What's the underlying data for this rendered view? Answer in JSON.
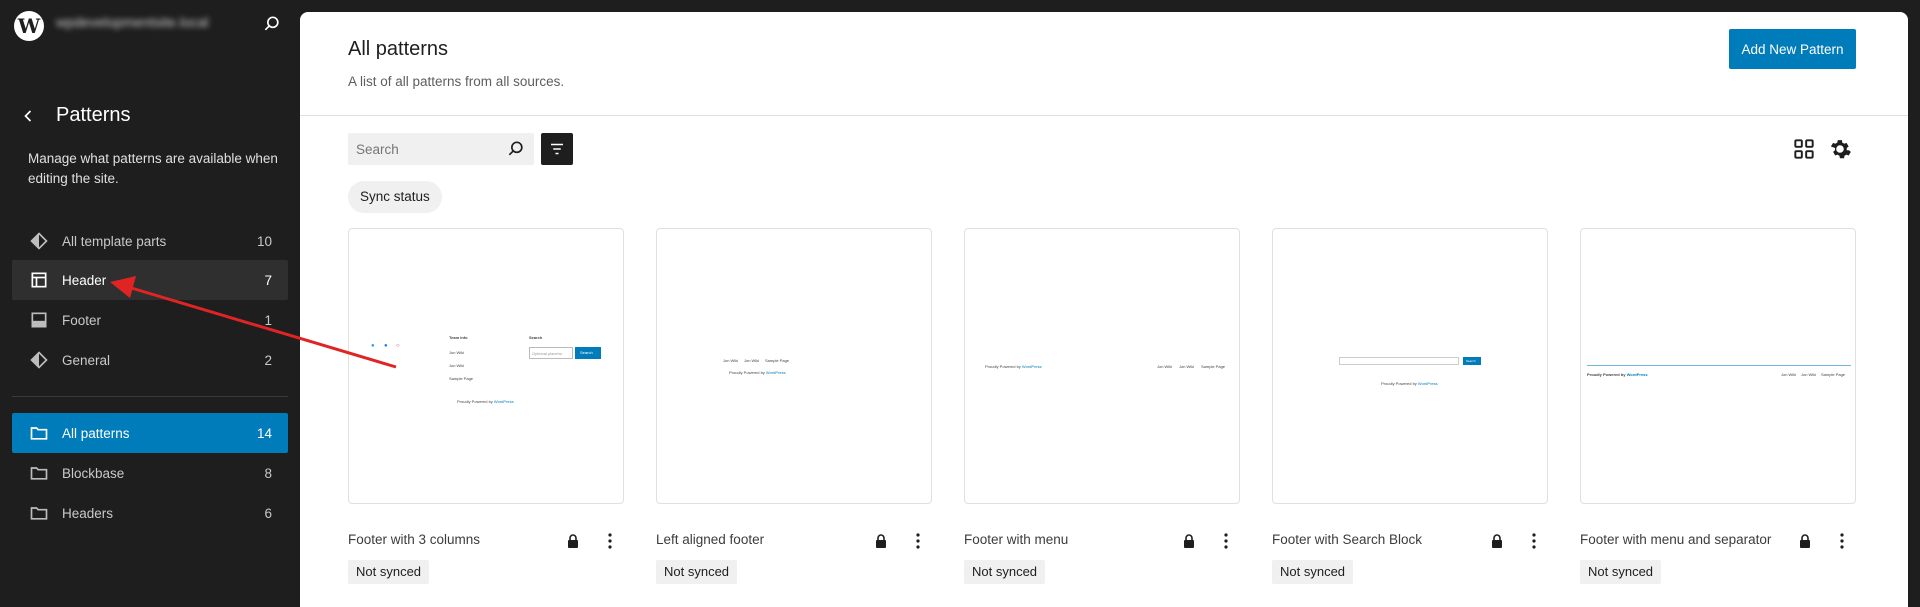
{
  "site": {
    "name": "wpdevelopmentsite.local"
  },
  "sidebar": {
    "title": "Patterns",
    "description": "Manage what patterns are available when editing the site.",
    "template_parts": [
      {
        "label": "All template parts",
        "count": "10"
      },
      {
        "label": "Header",
        "count": "7"
      },
      {
        "label": "Footer",
        "count": "1"
      },
      {
        "label": "General",
        "count": "2"
      }
    ],
    "categories": [
      {
        "label": "All patterns",
        "count": "14"
      },
      {
        "label": "Blockbase",
        "count": "8"
      },
      {
        "label": "Headers",
        "count": "6"
      }
    ]
  },
  "main": {
    "title": "All patterns",
    "description": "A list of all patterns from all sources.",
    "add_button": "Add New Pattern",
    "search_placeholder": "Search",
    "filter_chip": "Sync status"
  },
  "patterns": [
    {
      "title": "Footer with 3 columns",
      "status": "Not synced"
    },
    {
      "title": "Left aligned footer",
      "status": "Not synced"
    },
    {
      "title": "Footer with menu",
      "status": "Not synced"
    },
    {
      "title": "Footer with Search Block",
      "status": "Not synced"
    },
    {
      "title": "Footer with menu and separator",
      "status": "Not synced"
    }
  ],
  "previews": {
    "col1": [
      "Team Info",
      "Jon Wiki",
      "Jon Wiki",
      "Sample Page"
    ],
    "search_heading": "Search",
    "search_placeholder": "Optional placeho",
    "search_button": "Search",
    "search_button_2": "Search",
    "proudly": "Proudly Powered by",
    "wordpress": "WordPress",
    "menu": [
      "Jon Wiki",
      "Jon Wiki",
      "Sample Page"
    ]
  },
  "colors": {
    "accent": "#007cba",
    "sidebar_bg": "#1e1e1e",
    "arrow": "#e02424"
  }
}
